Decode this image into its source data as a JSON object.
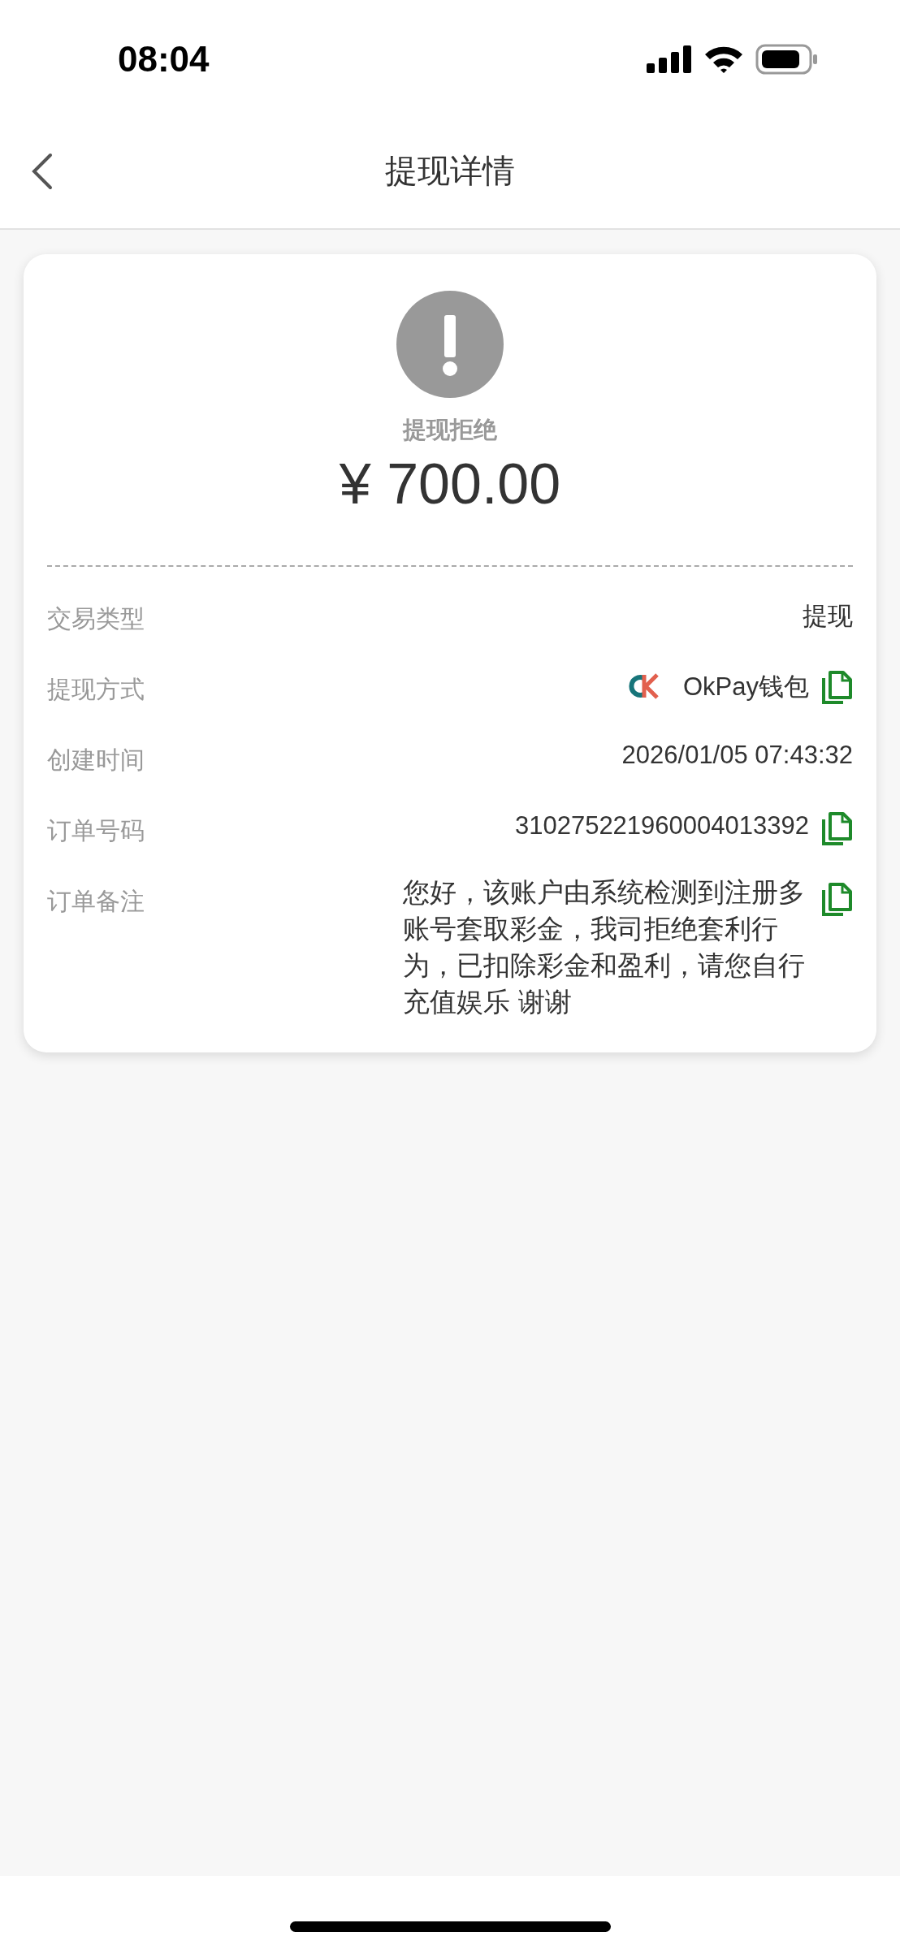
{
  "status_bar": {
    "time": "08:04"
  },
  "nav": {
    "title": "提现详情"
  },
  "summary": {
    "status": "提现拒绝",
    "amount": "¥ 700.00"
  },
  "details": [
    {
      "kind": "text",
      "label": "交易类型",
      "value": "提现",
      "copy": false
    },
    {
      "kind": "wallet",
      "label": "提现方式",
      "value": "OkPay钱包",
      "copy": true
    },
    {
      "kind": "text",
      "label": "创建时间",
      "value": "2026/01/05 07:43:32",
      "copy": false
    },
    {
      "kind": "text",
      "label": "订单号码",
      "value": "310275221960004013392",
      "copy": true
    },
    {
      "kind": "note",
      "label": "订单备注",
      "value": "您好，该账户由系统检测到注册多账号套取彩金，我司拒绝套利行为，已扣除彩金和盈利，请您自行充值娱乐 谢谢",
      "copy": true
    }
  ]
}
